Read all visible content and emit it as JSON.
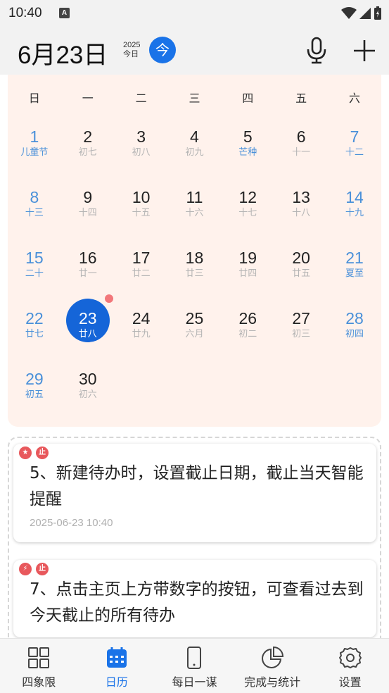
{
  "status_bar": {
    "time": "10:40",
    "notif_icon": "a-square-icon",
    "signal_icons": [
      "wifi-icon",
      "cell-signal-icon",
      "battery-icon"
    ]
  },
  "header": {
    "date_title": "6月23日",
    "year": "2025",
    "today_label": "今日",
    "today_button": "今",
    "mic_icon": "microphone-icon",
    "add_icon": "plus-icon"
  },
  "colors": {
    "accent": "#1a73e8",
    "calendar_bg": "#fff2ec",
    "weekend": "#4a90d9",
    "tag_red": "#e8585c",
    "marker": "#f2777a"
  },
  "calendar": {
    "weekdays": [
      "日",
      "一",
      "二",
      "三",
      "四",
      "五",
      "六"
    ],
    "weeks": [
      [
        {
          "num": "1",
          "lunar": "儿童节"
        },
        {
          "num": "2",
          "lunar": "初七"
        },
        {
          "num": "3",
          "lunar": "初八"
        },
        {
          "num": "4",
          "lunar": "初九"
        },
        {
          "num": "5",
          "lunar": "芒种"
        },
        {
          "num": "6",
          "lunar": "十一"
        },
        {
          "num": "7",
          "lunar": "十二"
        }
      ],
      [
        {
          "num": "8",
          "lunar": "十三"
        },
        {
          "num": "9",
          "lunar": "十四"
        },
        {
          "num": "10",
          "lunar": "十五"
        },
        {
          "num": "11",
          "lunar": "十六"
        },
        {
          "num": "12",
          "lunar": "十七"
        },
        {
          "num": "13",
          "lunar": "十八"
        },
        {
          "num": "14",
          "lunar": "十九"
        }
      ],
      [
        {
          "num": "15",
          "lunar": "二十"
        },
        {
          "num": "16",
          "lunar": "廿一"
        },
        {
          "num": "17",
          "lunar": "廿二"
        },
        {
          "num": "18",
          "lunar": "廿三"
        },
        {
          "num": "19",
          "lunar": "廿四"
        },
        {
          "num": "20",
          "lunar": "廿五"
        },
        {
          "num": "21",
          "lunar": "夏至"
        }
      ],
      [
        {
          "num": "22",
          "lunar": "廿七"
        },
        {
          "num": "23",
          "lunar": "廿八"
        },
        {
          "num": "24",
          "lunar": "廿九"
        },
        {
          "num": "25",
          "lunar": "六月"
        },
        {
          "num": "26",
          "lunar": "初二"
        },
        {
          "num": "27",
          "lunar": "初三"
        },
        {
          "num": "28",
          "lunar": "初四"
        }
      ],
      [
        {
          "num": "29",
          "lunar": "初五"
        },
        {
          "num": "30",
          "lunar": "初六"
        }
      ]
    ]
  },
  "tasks": [
    {
      "text": "5、新建待办时，设置截止日期，截止当天智能提醒",
      "time": "2025-06-23 10:40",
      "tags": [
        "star-tag-icon",
        "stop-tag-icon"
      ]
    },
    {
      "text": "7、点击主页上方带数字的按钮，可查看过去到今天截止的所有待办",
      "time": "",
      "tags": [
        "bolt-tag-icon",
        "stop-tag-icon"
      ]
    }
  ],
  "bottom_nav": {
    "items": [
      {
        "label": "四象限",
        "icon": "quadrant-grid-icon"
      },
      {
        "label": "日历",
        "icon": "calendar-icon"
      },
      {
        "label": "每日一谋",
        "icon": "phone-icon"
      },
      {
        "label": "完成与统计",
        "icon": "pie-chart-icon"
      },
      {
        "label": "设置",
        "icon": "gear-icon"
      }
    ]
  }
}
